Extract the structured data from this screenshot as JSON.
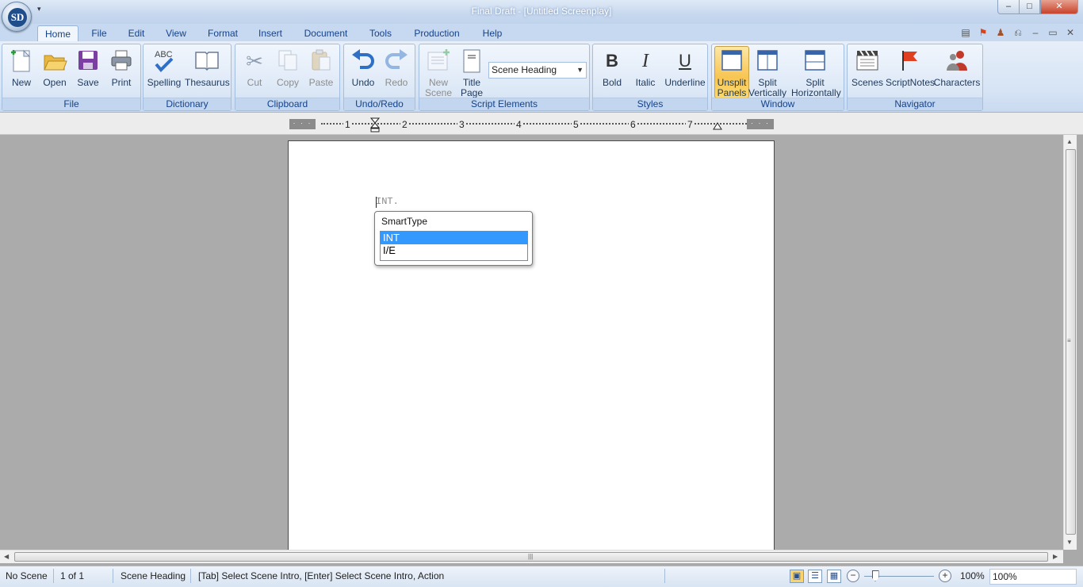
{
  "window": {
    "title": "Final Draft - [Untitled Screenplay]",
    "app_logo": "SD",
    "min_label": "–",
    "max_label": "□",
    "close_label": "✕",
    "qat_dropdown": "▾"
  },
  "ribbon_tabs": [
    "Home",
    "File",
    "Edit",
    "View",
    "Format",
    "Insert",
    "Document",
    "Tools",
    "Production",
    "Help"
  ],
  "active_tab": "Home",
  "groups": {
    "file": {
      "label": "File",
      "buttons": [
        {
          "label": "New",
          "icon": "new-document-icon"
        },
        {
          "label": "Open",
          "icon": "folder-open-icon"
        },
        {
          "label": "Save",
          "icon": "floppy-disk-icon"
        },
        {
          "label": "Print",
          "icon": "printer-icon"
        }
      ]
    },
    "dictionary": {
      "label": "Dictionary",
      "buttons": [
        {
          "label": "Spelling",
          "icon": "spellcheck-icon"
        },
        {
          "label": "Thesaurus",
          "icon": "book-icon"
        }
      ]
    },
    "clipboard": {
      "label": "Clipboard",
      "buttons": [
        {
          "label": "Cut",
          "icon": "scissors-icon",
          "disabled": true
        },
        {
          "label": "Copy",
          "icon": "copy-icon",
          "disabled": true
        },
        {
          "label": "Paste",
          "icon": "clipboard-icon",
          "disabled": true
        }
      ]
    },
    "undo_redo": {
      "label": "Undo/Redo",
      "buttons": [
        {
          "label": "Undo",
          "icon": "undo-arrow-icon"
        },
        {
          "label": "Redo",
          "icon": "redo-arrow-icon",
          "disabled": true
        }
      ]
    },
    "script_elements": {
      "label": "Script Elements",
      "new_scene": {
        "line1": "New",
        "line2": "Scene",
        "disabled": true
      },
      "title_page": {
        "line1": "Title",
        "line2": "Page"
      },
      "element_select": "Scene Heading"
    },
    "styles": {
      "label": "Styles",
      "buttons": [
        {
          "label": "Bold",
          "glyph": "B"
        },
        {
          "label": "Italic",
          "glyph": "I"
        },
        {
          "label": "Underline",
          "glyph": "U"
        }
      ]
    },
    "window": {
      "label": "Window",
      "unsplit": {
        "line1": "Unsplit",
        "line2": "Panels"
      },
      "split_v": {
        "line1": "Split",
        "line2": "Vertically"
      },
      "split_h": {
        "line1": "Split",
        "line2": "Horizontally"
      }
    },
    "navigator": {
      "label": "Navigator",
      "buttons": [
        {
          "label": "Scenes",
          "icon": "clapperboard-icon"
        },
        {
          "label": "ScriptNotes",
          "icon": "red-flag-icon"
        },
        {
          "label": "Characters",
          "icon": "people-icon"
        }
      ]
    }
  },
  "ruler": {
    "numbers": [
      "1",
      "2",
      "3",
      "4",
      "5",
      "6",
      "7"
    ],
    "margin_marks": "· · ·"
  },
  "document": {
    "text": "INT."
  },
  "smarttype": {
    "title": "SmartType",
    "items": [
      "INT",
      "I/E"
    ],
    "selected_index": 0
  },
  "statusbar": {
    "scene": "No Scene",
    "page": "1  of  1",
    "element": "Scene Heading",
    "hint": "[Tab]  Select Scene Intro,  [Enter] Select Scene Intro, Action",
    "zoom_percent": "100%",
    "zoom_value": "100%",
    "zoom_level": 0.5
  },
  "colors": {
    "ribbon_text": "#15428b",
    "selected_item": "#3399ff",
    "pressed_button": "#f8c552",
    "flag": "#d9441c"
  }
}
